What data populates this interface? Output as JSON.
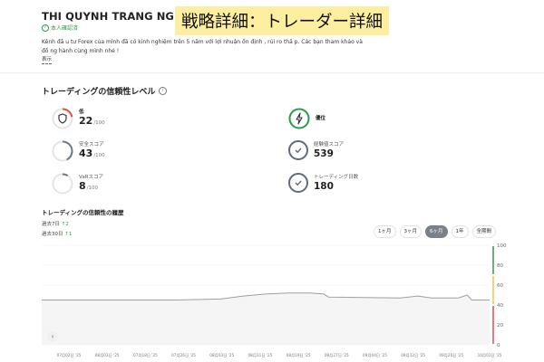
{
  "header": {
    "trader_name": "THI QUYNH TRANG NGUYEN",
    "banner": "戦略詳細：トレーダー詳細",
    "verified_label": "本人確認済",
    "description": "Kênh đầ u tư Forex của mình đã có kinh nghiệm trên 5 năm với lợi nhuận ổn định , rủi ro thấ p. Các bạn tham khảo và đồ ng hành cùng mình nhé !",
    "more_label": "表示"
  },
  "reliability": {
    "title": "トレーディングの信頼性レベル",
    "level": {
      "label": "低",
      "value": "22",
      "suffix": "/100",
      "icon": "shield-icon",
      "ring_color": "#e5533b"
    },
    "safety": {
      "label": "安全スコア",
      "value": "43",
      "suffix": "/100"
    },
    "var": {
      "label": "VaRスコア",
      "value": "8",
      "suffix": "/100"
    },
    "rank": {
      "label": "優位",
      "icon": "bolt-icon",
      "ring_color": "#2e9a4a"
    },
    "experience": {
      "label": "経験値スコア",
      "value": "539"
    },
    "trading_days": {
      "label": "トレーディング日数",
      "value": "180"
    }
  },
  "history": {
    "title": "トレーディングの信頼性の履歴",
    "past7": {
      "label": "過去7日",
      "arrow": "↑",
      "value": "2"
    },
    "past30": {
      "label": "過去30日",
      "arrow": "↑",
      "value": "1"
    },
    "tabs": [
      "1ヶ月",
      "3ヶ月",
      "6ヶ月",
      "1年",
      "全期間"
    ],
    "active_tab": "6ヶ月",
    "prev_icon": "chevron-left-icon"
  },
  "chart_data": {
    "type": "line",
    "ylim": [
      0,
      100
    ],
    "y_ticks": [
      "100",
      "80",
      "60",
      "40",
      "20",
      "0"
    ],
    "x_tick_labels": [
      "07月02日 '25",
      "08月03日 '25",
      "07月18日 '25",
      "07月26日 '25",
      "08月03日 '25",
      "08月11日 '25",
      "08月19日 '25",
      "08月27日 '25",
      "09月04日 '25",
      "09月12日 '25",
      "09月20日 '25",
      "10月01日 '25"
    ],
    "series": [
      {
        "color": "#9aa0a6",
        "points": [
          [
            0,
            45
          ],
          [
            30,
            45
          ],
          [
            40,
            46
          ],
          [
            45,
            49
          ],
          [
            50,
            51
          ],
          [
            55,
            52
          ],
          [
            60,
            52
          ],
          [
            63,
            51
          ],
          [
            64,
            48
          ],
          [
            80,
            47
          ],
          [
            84,
            49
          ],
          [
            87,
            47
          ],
          [
            93,
            47
          ],
          [
            95,
            50
          ],
          [
            96,
            45
          ],
          [
            100,
            45
          ]
        ]
      }
    ],
    "grid": true,
    "band_colors": [
      "#2e9a4a",
      "#f2c14e",
      "#e24b4b"
    ]
  }
}
